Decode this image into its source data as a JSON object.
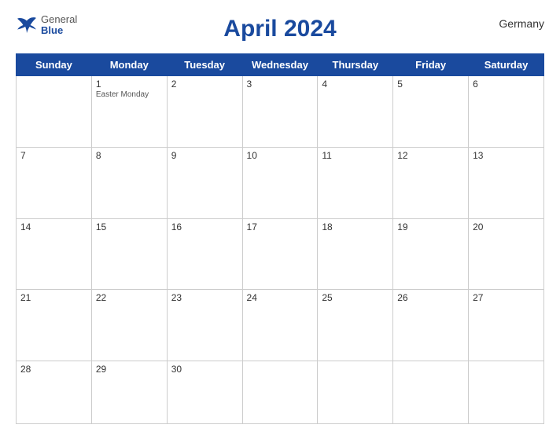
{
  "header": {
    "title": "April 2024",
    "country": "Germany",
    "logo": {
      "line1": "General",
      "line2": "Blue"
    }
  },
  "days_of_week": [
    "Sunday",
    "Monday",
    "Tuesday",
    "Wednesday",
    "Thursday",
    "Friday",
    "Saturday"
  ],
  "weeks": [
    [
      {
        "day": "",
        "holiday": ""
      },
      {
        "day": "1",
        "holiday": "Easter Monday"
      },
      {
        "day": "2",
        "holiday": ""
      },
      {
        "day": "3",
        "holiday": ""
      },
      {
        "day": "4",
        "holiday": ""
      },
      {
        "day": "5",
        "holiday": ""
      },
      {
        "day": "6",
        "holiday": ""
      }
    ],
    [
      {
        "day": "7",
        "holiday": ""
      },
      {
        "day": "8",
        "holiday": ""
      },
      {
        "day": "9",
        "holiday": ""
      },
      {
        "day": "10",
        "holiday": ""
      },
      {
        "day": "11",
        "holiday": ""
      },
      {
        "day": "12",
        "holiday": ""
      },
      {
        "day": "13",
        "holiday": ""
      }
    ],
    [
      {
        "day": "14",
        "holiday": ""
      },
      {
        "day": "15",
        "holiday": ""
      },
      {
        "day": "16",
        "holiday": ""
      },
      {
        "day": "17",
        "holiday": ""
      },
      {
        "day": "18",
        "holiday": ""
      },
      {
        "day": "19",
        "holiday": ""
      },
      {
        "day": "20",
        "holiday": ""
      }
    ],
    [
      {
        "day": "21",
        "holiday": ""
      },
      {
        "day": "22",
        "holiday": ""
      },
      {
        "day": "23",
        "holiday": ""
      },
      {
        "day": "24",
        "holiday": ""
      },
      {
        "day": "25",
        "holiday": ""
      },
      {
        "day": "26",
        "holiday": ""
      },
      {
        "day": "27",
        "holiday": ""
      }
    ],
    [
      {
        "day": "28",
        "holiday": ""
      },
      {
        "day": "29",
        "holiday": ""
      },
      {
        "day": "30",
        "holiday": ""
      },
      {
        "day": "",
        "holiday": ""
      },
      {
        "day": "",
        "holiday": ""
      },
      {
        "day": "",
        "holiday": ""
      },
      {
        "day": "",
        "holiday": ""
      }
    ]
  ],
  "colors": {
    "header_bg": "#1a4a9e",
    "header_text": "#ffffff",
    "title_color": "#1a4a9e"
  }
}
